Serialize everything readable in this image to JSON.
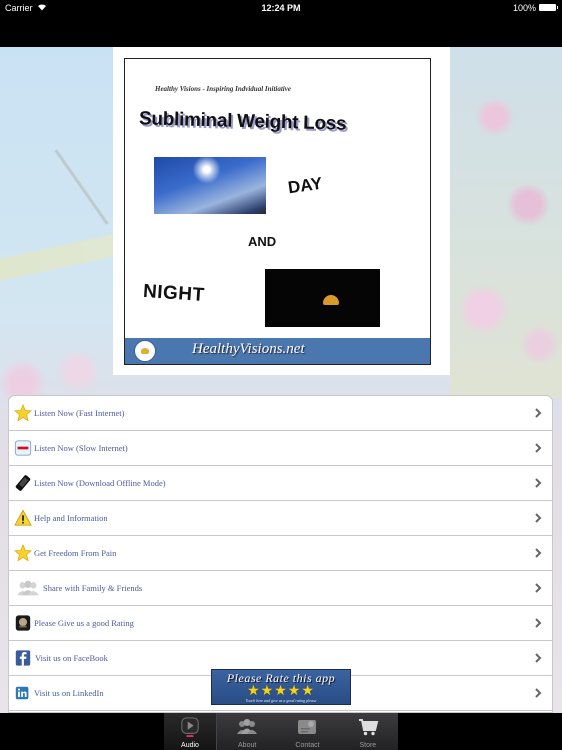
{
  "status_bar": {
    "carrier": "Carrier",
    "time": "12:24 PM",
    "battery_percent": "100%"
  },
  "cover": {
    "tagline": "Healthy Visions - Inspiring Indvidual Initiative",
    "title": "Subliminal Weight Loss",
    "word_day": "DAY",
    "word_and": "AND",
    "word_night": "NIGHT",
    "footer_site": "HealthyVisions.net"
  },
  "menu": {
    "items": [
      {
        "label": "Listen Now (Fast Internet)",
        "icon": "star-icon"
      },
      {
        "label": "Listen Now (Slow Internet)",
        "icon": "no-entry-icon"
      },
      {
        "label": "Listen Now (Download Offline Mode)",
        "icon": "mobile-device-icon"
      },
      {
        "label": "Help and Information",
        "icon": "warning-icon"
      },
      {
        "label": "Get Freedom From Pain",
        "icon": "star-icon"
      },
      {
        "label": "Share with Family & Friends",
        "icon": "people-icon"
      },
      {
        "label": "Please Give us a good Rating",
        "icon": "app-rating-icon"
      },
      {
        "label": "Visit us on FaceBook",
        "icon": "facebook-icon"
      },
      {
        "label": "Visit us on LinkedIn",
        "icon": "linkedin-icon"
      }
    ]
  },
  "rate_banner": {
    "title": "Please Rate this app",
    "stars": "★★★★★",
    "rating": 5,
    "subtitle": "Touch here and give us a good rating please"
  },
  "tab_bar": {
    "tabs": [
      {
        "label": "Audio",
        "icon": "play-icon",
        "active": true
      },
      {
        "label": "About",
        "icon": "people-icon",
        "active": false
      },
      {
        "label": "Contact",
        "icon": "contact-card-icon",
        "active": false
      },
      {
        "label": "Store",
        "icon": "cart-icon",
        "active": false
      }
    ]
  }
}
